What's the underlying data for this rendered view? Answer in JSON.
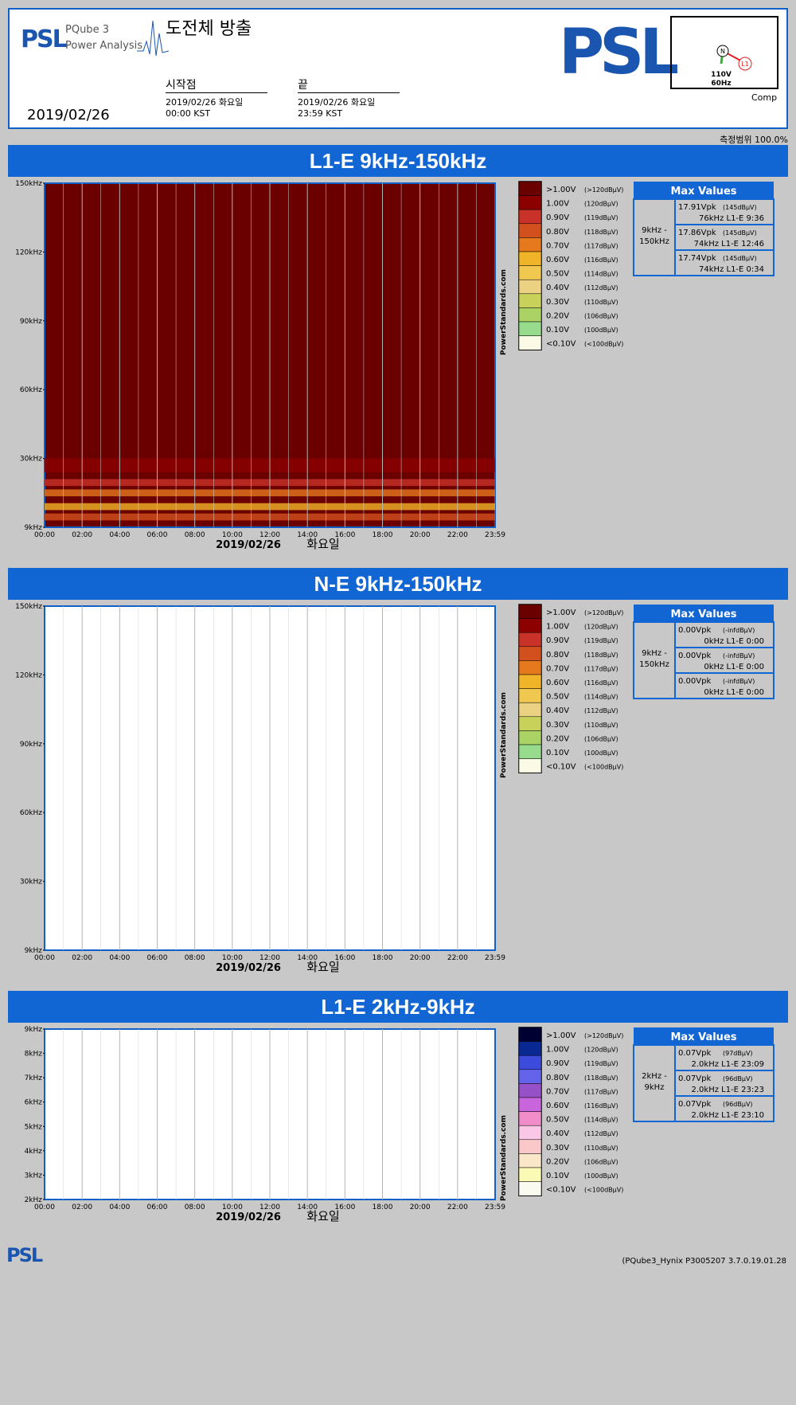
{
  "header": {
    "logo_small": "PSL",
    "product": "PQube 3",
    "subtitle": "Power Analysis",
    "title": "도전체 방출",
    "start_label": "시작점",
    "end_label": "끝",
    "start_date": "2019/02/26 화요일",
    "start_time": "00:00 KST",
    "end_date": "2019/02/26 화요일",
    "end_time": "23:59 KST",
    "report_date": "2019/02/26",
    "logo_big": "PSL",
    "phase": {
      "n": "N",
      "l1": "L1",
      "voltage": "110V",
      "freq": "60Hz"
    },
    "comp": "Comp",
    "coverage": "측정범위 100.0%"
  },
  "colors": {
    "accent": "#1266d4",
    "red_scale": [
      "#6b0000",
      "#8c0000",
      "#c83228",
      "#d2501e",
      "#e6781e",
      "#f0b428",
      "#f0c850",
      "#ebd282",
      "#c8d25a",
      "#aad264",
      "#96dc8c",
      "#fafae6"
    ],
    "blue_scale": [
      "#000032",
      "#0a2891",
      "#3c4bdc",
      "#6464eb",
      "#9650c8",
      "#c864dc",
      "#f08cc8",
      "#fac8e6",
      "#fac8c8",
      "#fae6c8",
      "#fafab4",
      "#fafaf0"
    ]
  },
  "legend_labels": [
    {
      "v": ">1.00V",
      "db": "(>120dBµV)"
    },
    {
      "v": "1.00V",
      "db": "(120dBµV)"
    },
    {
      "v": "0.90V",
      "db": "(119dBµV)"
    },
    {
      "v": "0.80V",
      "db": "(118dBµV)"
    },
    {
      "v": "0.70V",
      "db": "(117dBµV)"
    },
    {
      "v": "0.60V",
      "db": "(116dBµV)"
    },
    {
      "v": "0.50V",
      "db": "(114dBµV)"
    },
    {
      "v": "0.40V",
      "db": "(112dBµV)"
    },
    {
      "v": "0.30V",
      "db": "(110dBµV)"
    },
    {
      "v": "0.20V",
      "db": "(106dBµV)"
    },
    {
      "v": "0.10V",
      "db": "(100dBµV)"
    },
    {
      "v": "<0.10V",
      "db": "(<100dBµV)"
    }
  ],
  "watermark": "PowerStandards.com",
  "max_values_label": "Max Values",
  "footer": {
    "logo": "PSL",
    "version": "(PQube3_Hynix   P3005207  3.7.0.19.01.28"
  },
  "chart_data": [
    {
      "type": "heatmap",
      "title": "L1-E 9kHz-150kHz",
      "x_ticks": [
        "00:00",
        "02:00",
        "04:00",
        "06:00",
        "08:00",
        "10:00",
        "12:00",
        "14:00",
        "16:00",
        "18:00",
        "20:00",
        "22:00",
        "23:59"
      ],
      "y_ticks": [
        "150kHz",
        "120kHz",
        "90kHz",
        "60kHz",
        "30kHz",
        "9kHz"
      ],
      "ylim": [
        9,
        150
      ],
      "y_unit": "kHz",
      "x_date": "2019/02/26",
      "x_day": "화요일",
      "scale": "red",
      "fill": "high",
      "range_label": "9kHz - 150kHz",
      "max_values": [
        {
          "v": "17.91Vpk",
          "db": "(145dBµV)",
          "detail": "76kHz  L1-E  9:36"
        },
        {
          "v": "17.86Vpk",
          "db": "(145dBµV)",
          "detail": "74kHz  L1-E  12:46"
        },
        {
          "v": "17.74Vpk",
          "db": "(145dBµV)",
          "detail": "74kHz  L1-E  0:34"
        }
      ]
    },
    {
      "type": "heatmap",
      "title": "N-E 9kHz-150kHz",
      "x_ticks": [
        "00:00",
        "02:00",
        "04:00",
        "06:00",
        "08:00",
        "10:00",
        "12:00",
        "14:00",
        "16:00",
        "18:00",
        "20:00",
        "22:00",
        "23:59"
      ],
      "y_ticks": [
        "150kHz",
        "120kHz",
        "90kHz",
        "60kHz",
        "30kHz",
        "9kHz"
      ],
      "ylim": [
        9,
        150
      ],
      "y_unit": "kHz",
      "x_date": "2019/02/26",
      "x_day": "화요일",
      "scale": "red",
      "fill": "none",
      "range_label": "9kHz - 150kHz",
      "max_values": [
        {
          "v": "0.00Vpk",
          "db": "(-infdBµV)",
          "detail": "0kHz  L1-E  0:00"
        },
        {
          "v": "0.00Vpk",
          "db": "(-infdBµV)",
          "detail": "0kHz  L1-E  0:00"
        },
        {
          "v": "0.00Vpk",
          "db": "(-infdBµV)",
          "detail": "0kHz  L1-E  0:00"
        }
      ]
    },
    {
      "type": "heatmap",
      "title": "L1-E 2kHz-9kHz",
      "x_ticks": [
        "00:00",
        "02:00",
        "04:00",
        "06:00",
        "08:00",
        "10:00",
        "12:00",
        "14:00",
        "16:00",
        "18:00",
        "20:00",
        "22:00",
        "23:59"
      ],
      "y_ticks": [
        "9kHz",
        "8kHz",
        "7kHz",
        "6kHz",
        "5kHz",
        "4kHz",
        "3kHz",
        "2kHz"
      ],
      "ylim": [
        2,
        9
      ],
      "y_unit": "kHz",
      "x_date": "2019/02/26",
      "x_day": "화요일",
      "scale": "blue",
      "fill": "none",
      "range_label": "2kHz - 9kHz",
      "max_values": [
        {
          "v": "0.07Vpk",
          "db": "(97dBµV)",
          "detail": "2.0kHz  L1-E  23:09"
        },
        {
          "v": "0.07Vpk",
          "db": "(96dBµV)",
          "detail": "2.0kHz  L1-E  23:23"
        },
        {
          "v": "0.07Vpk",
          "db": "(96dBµV)",
          "detail": "2.0kHz  L1-E  23:10"
        }
      ]
    }
  ]
}
